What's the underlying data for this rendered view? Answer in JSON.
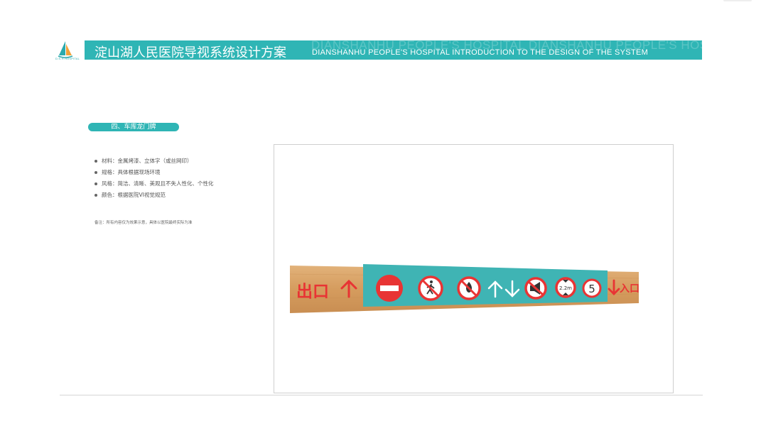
{
  "header": {
    "logo_icon": "sailboat-logo-icon",
    "logo_text": "D.S.H HOSPITAL",
    "title_cn": "淀山湖人民医院导视系统设计方案",
    "title_en": "DIANSHANHU PEOPLE'S HOSPITAL INTRODUCTION TO THE DESIGN OF THE SYSTEM",
    "watermark": "DIANSHANHU PEOPLE'S HOSPITAL DIANSHANHU PEOPLE'S HOS",
    "accent": "#2fb5b5"
  },
  "section": {
    "title": "四、车库龙门牌"
  },
  "specs": [
    {
      "label": "材料：金属烤漆、立体字（或丝网印）"
    },
    {
      "label": "规格：具体根据现场环境"
    },
    {
      "label": "风格：简洁、清晰、美观且不失人性化、个性化"
    },
    {
      "label": "颜色：根据医院VI视觉规范"
    }
  ],
  "note": "备注：所有内容仅为效果示意，具体以医院最终实际为准",
  "sign": {
    "exit_label": "出口",
    "entrance_label": "入口",
    "speed_limit": "5",
    "height_limit": "2.2m",
    "icons": [
      "no-entry-icon",
      "no-pedestrians-icon",
      "no-fire-icon",
      "up-arrow-icon",
      "down-arrow-icon",
      "no-horn-icon",
      "height-limit-icon",
      "speed-limit-icon"
    ],
    "colors": {
      "wood": "#d9a366",
      "panel": "#3fb4b4",
      "red": "#e83434"
    }
  }
}
